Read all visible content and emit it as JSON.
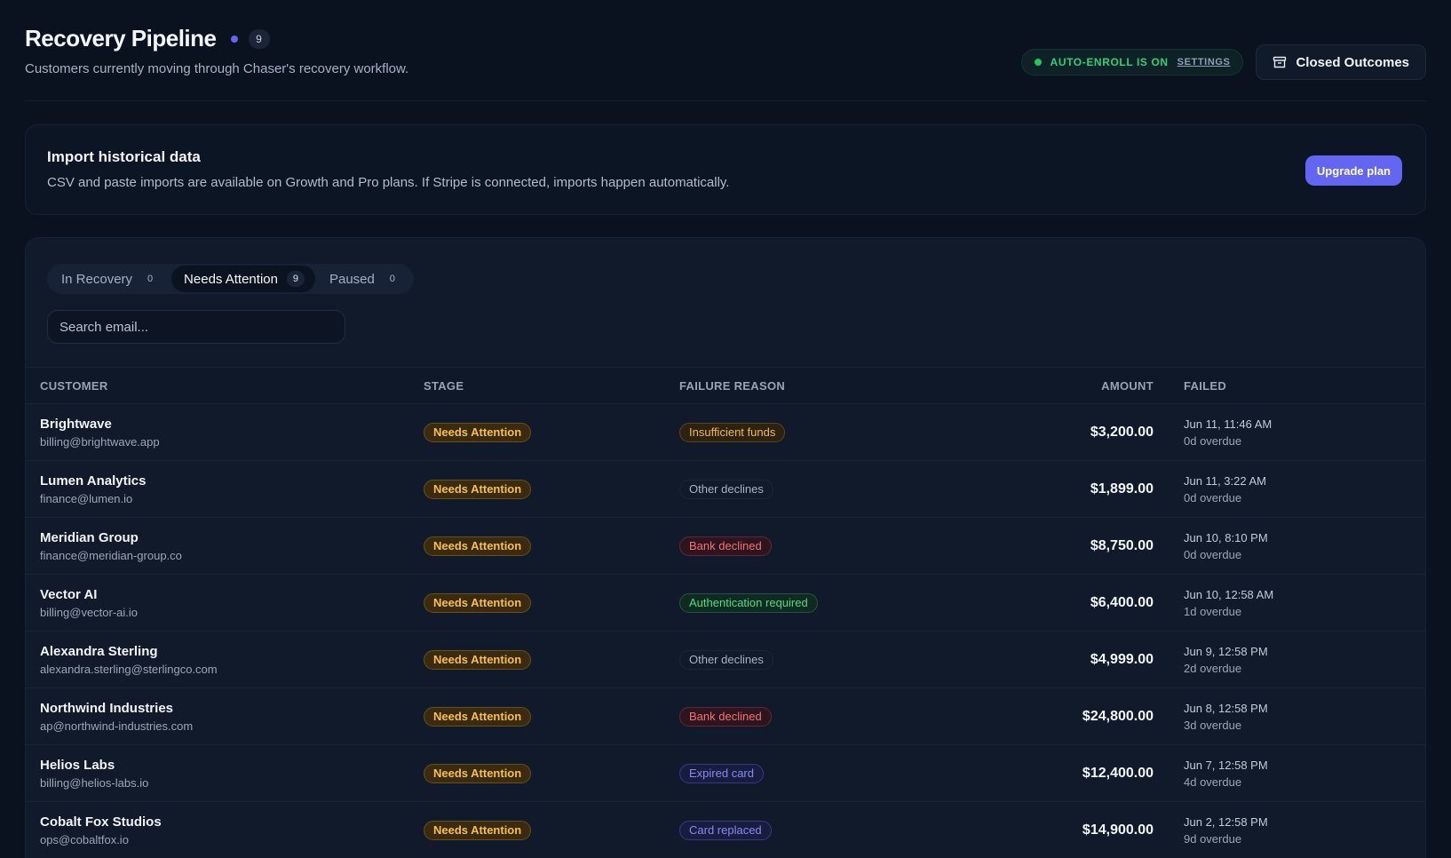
{
  "header": {
    "title": "Recovery Pipeline",
    "count": "9",
    "subtitle": "Customers currently moving through Chaser's recovery workflow.",
    "autoenroll_label": "AUTO-ENROLL IS ON",
    "settings_label": "SETTINGS",
    "closed_outcomes_label": "Closed Outcomes"
  },
  "import_card": {
    "title": "Import historical data",
    "description": "CSV and paste imports are available on Growth and Pro plans. If Stripe is connected, imports happen automatically.",
    "upgrade_label": "Upgrade plan"
  },
  "tabs": [
    {
      "label": "In Recovery",
      "count": "0"
    },
    {
      "label": "Needs Attention",
      "count": "9"
    },
    {
      "label": "Paused",
      "count": "0"
    }
  ],
  "search": {
    "placeholder": "Search email..."
  },
  "table": {
    "headers": {
      "customer": "CUSTOMER",
      "stage": "STAGE",
      "reason": "FAILURE REASON",
      "amount": "AMOUNT",
      "failed": "FAILED"
    },
    "rows": [
      {
        "name": "Brightwave",
        "email": "billing@brightwave.app",
        "stage": "Needs Attention",
        "reason": "Insufficient funds",
        "reason_color": "#f5b94a",
        "reason_bg": "#2c2211",
        "reason_border": "#5e4416",
        "amount": "$3,200.00",
        "failed": "Jun 11, 11:46 AM",
        "overdue": "0d overdue"
      },
      {
        "name": "Lumen Analytics",
        "email": "finance@lumen.io",
        "stage": "Needs Attention",
        "reason": "Other declines",
        "reason_color": "#a8b2c2",
        "reason_bg": "#111a2a",
        "reason_border": "#1c2638",
        "amount": "$1,899.00",
        "failed": "Jun 11, 3:22 AM",
        "overdue": "0d overdue"
      },
      {
        "name": "Meridian Group",
        "email": "finance@meridian-group.co",
        "stage": "Needs Attention",
        "reason": "Bank declined",
        "reason_color": "#f87171",
        "reason_bg": "#2d1520",
        "reason_border": "#6a2431",
        "amount": "$8,750.00",
        "failed": "Jun 10, 8:10 PM",
        "overdue": "0d overdue"
      },
      {
        "name": "Vector AI",
        "email": "billing@vector-ai.io",
        "stage": "Needs Attention",
        "reason": "Authentication required",
        "reason_color": "#4ade80",
        "reason_bg": "#0f2a22",
        "reason_border": "#1c5a3a",
        "amount": "$6,400.00",
        "failed": "Jun 10, 12:58 AM",
        "overdue": "1d overdue"
      },
      {
        "name": "Alexandra Sterling",
        "email": "alexandra.sterling@sterlingco.com",
        "stage": "Needs Attention",
        "reason": "Other declines",
        "reason_color": "#a8b2c2",
        "reason_bg": "#111a2a",
        "reason_border": "#1c2638",
        "amount": "$4,999.00",
        "failed": "Jun 9, 12:58 PM",
        "overdue": "2d overdue"
      },
      {
        "name": "Northwind Industries",
        "email": "ap@northwind-industries.com",
        "stage": "Needs Attention",
        "reason": "Bank declined",
        "reason_color": "#f87171",
        "reason_bg": "#2d1520",
        "reason_border": "#6a2431",
        "amount": "$24,800.00",
        "failed": "Jun 8, 12:58 PM",
        "overdue": "3d overdue"
      },
      {
        "name": "Helios Labs",
        "email": "billing@helios-labs.io",
        "stage": "Needs Attention",
        "reason": "Expired card",
        "reason_color": "#818cf8",
        "reason_bg": "#1a1c3e",
        "reason_border": "#343a8a",
        "amount": "$12,400.00",
        "failed": "Jun 7, 12:58 PM",
        "overdue": "4d overdue"
      },
      {
        "name": "Cobalt Fox Studios",
        "email": "ops@cobaltfox.io",
        "stage": "Needs Attention",
        "reason": "Card replaced",
        "reason_color": "#818cf8",
        "reason_bg": "#1a1c3e",
        "reason_border": "#343a8a",
        "amount": "$14,900.00",
        "failed": "Jun 2, 12:58 PM",
        "overdue": "9d overdue"
      }
    ]
  },
  "colors": {
    "accent": "#6366f1",
    "success": "#22c55e",
    "warning": "#f7c04a",
    "background": "#0a1220"
  }
}
